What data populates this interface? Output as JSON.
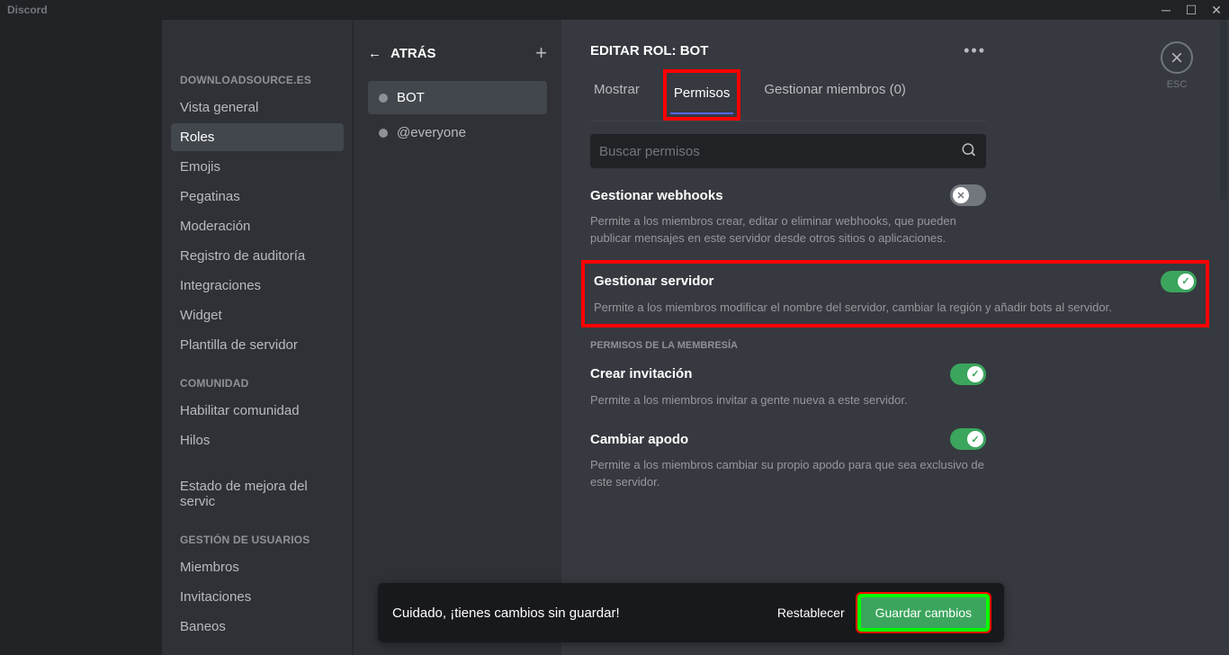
{
  "titlebar": {
    "brand": "Discord"
  },
  "sidebar": {
    "section1": "DOWNLOADSOURCE.ES",
    "items1": [
      "Vista general",
      "Roles",
      "Emojis",
      "Pegatinas",
      "Moderación",
      "Registro de auditoría",
      "Integraciones",
      "Widget",
      "Plantilla de servidor"
    ],
    "section2": "COMUNIDAD",
    "items2": [
      "Habilitar comunidad",
      "Hilos",
      "Estado de mejora del servic"
    ],
    "section3": "GESTIÓN DE USUARIOS",
    "items3": [
      "Miembros",
      "Invitaciones",
      "Baneos"
    ]
  },
  "roles": {
    "back": "ATRÁS",
    "items": [
      "BOT",
      "@everyone"
    ]
  },
  "main": {
    "title": "EDITAR ROL: BOT",
    "esc": "ESC",
    "tabs": {
      "display": "Mostrar",
      "permissions": "Permisos",
      "members": "Gestionar miembros (0)"
    },
    "search_placeholder": "Buscar permisos",
    "perm_webhooks": {
      "title": "Gestionar webhooks",
      "desc": "Permite a los miembros crear, editar o eliminar webhooks, que pueden publicar mensajes en este servidor desde otros sitios o aplicaciones."
    },
    "perm_server": {
      "title": "Gestionar servidor",
      "desc": "Permite a los miembros modificar el nombre del servidor, cambiar la región y añadir bots al servidor."
    },
    "section_membership": "PERMISOS DE LA MEMBRESÍA",
    "perm_invite": {
      "title": "Crear invitación",
      "desc": "Permite a los miembros invitar a gente nueva a este servidor."
    },
    "perm_nickname": {
      "title": "Cambiar apodo",
      "desc": "Permite a los miembros cambiar su propio apodo para que sea exclusivo de este servidor."
    },
    "save_bar": {
      "msg": "Cuidado, ¡tienes cambios sin guardar!",
      "reset": "Restablecer",
      "save": "Guardar cambios"
    }
  }
}
